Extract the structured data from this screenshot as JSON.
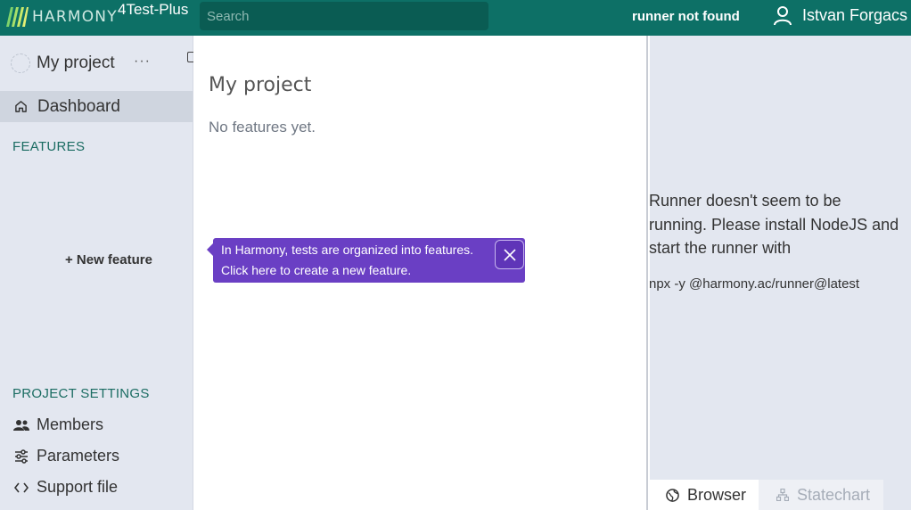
{
  "header": {
    "logo_text": "HARMONY",
    "org_name": "4Test-Plus",
    "search_placeholder": "Search",
    "runner_status": "runner not found",
    "user_name": "Istvan Forgacs"
  },
  "sidebar": {
    "project_name": "My project",
    "more_label": "···",
    "dashboard_label": "Dashboard",
    "features_title": "FEATURES",
    "new_feature_label": "+ New feature",
    "settings_title": "PROJECT SETTINGS",
    "settings_items": [
      {
        "label": "Members",
        "icon": "people-icon"
      },
      {
        "label": "Parameters",
        "icon": "sliders-icon"
      },
      {
        "label": "Support file",
        "icon": "code-icon"
      }
    ]
  },
  "main": {
    "title": "My project",
    "empty_text": "No features yet."
  },
  "tooltip": {
    "line1": "In Harmony, tests are organized into features.",
    "line2": "Click here to create a new feature."
  },
  "runner_panel": {
    "message": "Runner doesn't seem to be running. Please install NodeJS and start the runner with",
    "command": "npx -y @harmony.ac/runner@latest",
    "tabs": [
      {
        "label": "Browser",
        "icon": "globe-icon",
        "active": true
      },
      {
        "label": "Statechart",
        "icon": "hierarchy-icon",
        "active": false
      }
    ]
  },
  "colors": {
    "header_bg": "#0d7066",
    "sidebar_bg": "#e3e7f0",
    "accent_teal": "#1a6c62",
    "tooltip_bg": "#6a3fc4"
  }
}
